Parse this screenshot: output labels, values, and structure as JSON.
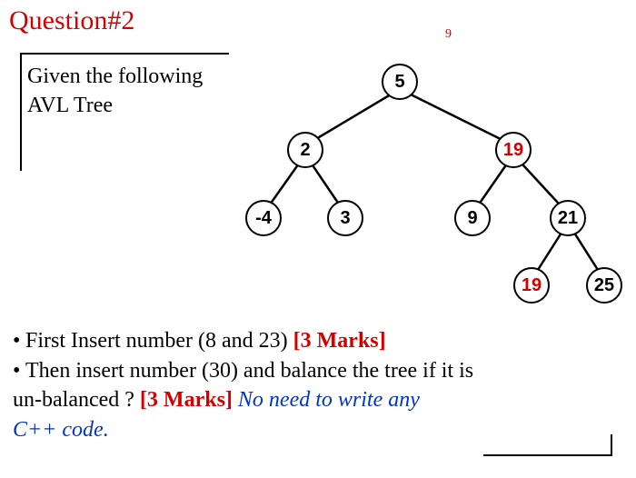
{
  "header": {
    "title": "Question#2",
    "slide_number": "9"
  },
  "prompt": {
    "line1": "Given the following",
    "line2": "AVL Tree"
  },
  "tree": {
    "nodes": {
      "root": "5",
      "l": "2",
      "r": "19",
      "ll": "-4",
      "lr": "3",
      "rl": "9",
      "rr": "21",
      "rrl": "19",
      "rrr": "25"
    }
  },
  "instructions": {
    "bullet_glyph": "•",
    "line1_a": "First Insert number (8 and 23) ",
    "line1_marks": "[3 Marks]",
    "line2_a": "Then insert number (30) and balance the tree if it is",
    "line3_a": "un-balanced ?   ",
    "line3_marks": "[3 Marks]",
    "line3_sep": "   ",
    "line3_note_a": "No need to write any",
    "line4_note": "C++ code."
  }
}
